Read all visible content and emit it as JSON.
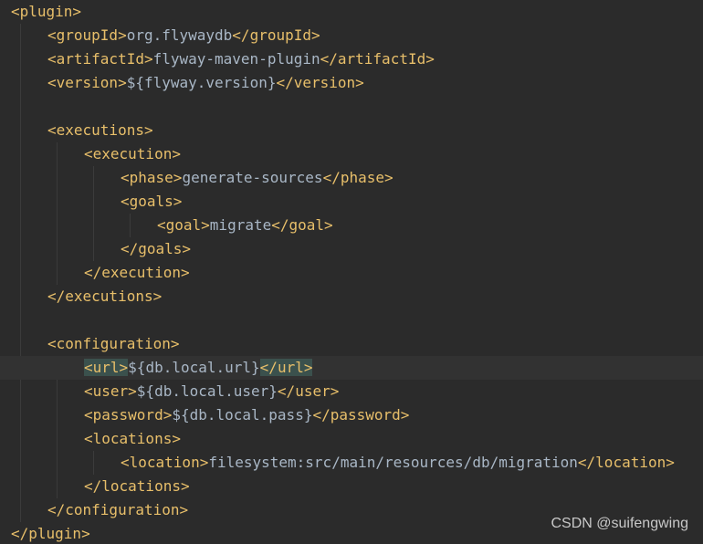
{
  "colors": {
    "background": "#2b2b2b",
    "tag": "#e8bf6a",
    "text": "#a9b7c6",
    "current_line": "#323232",
    "match_highlight": "#3b514d"
  },
  "code": {
    "lines": [
      {
        "open": "<plugin>",
        "value": "",
        "close": ""
      },
      {
        "open": "<groupId>",
        "value": "org.flywaydb",
        "close": "</groupId>"
      },
      {
        "open": "<artifactId>",
        "value": "flyway-maven-plugin",
        "close": "</artifactId>"
      },
      {
        "open": "<version>",
        "value": "${flyway.version}",
        "close": "</version>"
      },
      {
        "open": "",
        "value": "",
        "close": ""
      },
      {
        "open": "<executions>",
        "value": "",
        "close": ""
      },
      {
        "open": "<execution>",
        "value": "",
        "close": ""
      },
      {
        "open": "<phase>",
        "value": "generate-sources",
        "close": "</phase>"
      },
      {
        "open": "<goals>",
        "value": "",
        "close": ""
      },
      {
        "open": "<goal>",
        "value": "migrate",
        "close": "</goal>"
      },
      {
        "open": "",
        "value": "",
        "close": "</goals>"
      },
      {
        "open": "",
        "value": "",
        "close": "</execution>"
      },
      {
        "open": "",
        "value": "",
        "close": "</executions>"
      },
      {
        "open": "",
        "value": "",
        "close": ""
      },
      {
        "open": "<configuration>",
        "value": "",
        "close": ""
      },
      {
        "open": "<url>",
        "value": "${db.local.url}",
        "close": "</url>"
      },
      {
        "open": "<user>",
        "value": "${db.local.user}",
        "close": "</user>"
      },
      {
        "open": "<password>",
        "value": "${db.local.pass}",
        "close": "</password>"
      },
      {
        "open": "<locations>",
        "value": "",
        "close": ""
      },
      {
        "open": "<location>",
        "value": "filesystem:src/main/resources/db/migration",
        "close": "</location>"
      },
      {
        "open": "",
        "value": "",
        "close": "</locations>"
      },
      {
        "open": "",
        "value": "",
        "close": "</configuration>"
      },
      {
        "open": "",
        "value": "",
        "close": "</plugin>"
      }
    ]
  },
  "watermark": "CSDN @suifengwing"
}
